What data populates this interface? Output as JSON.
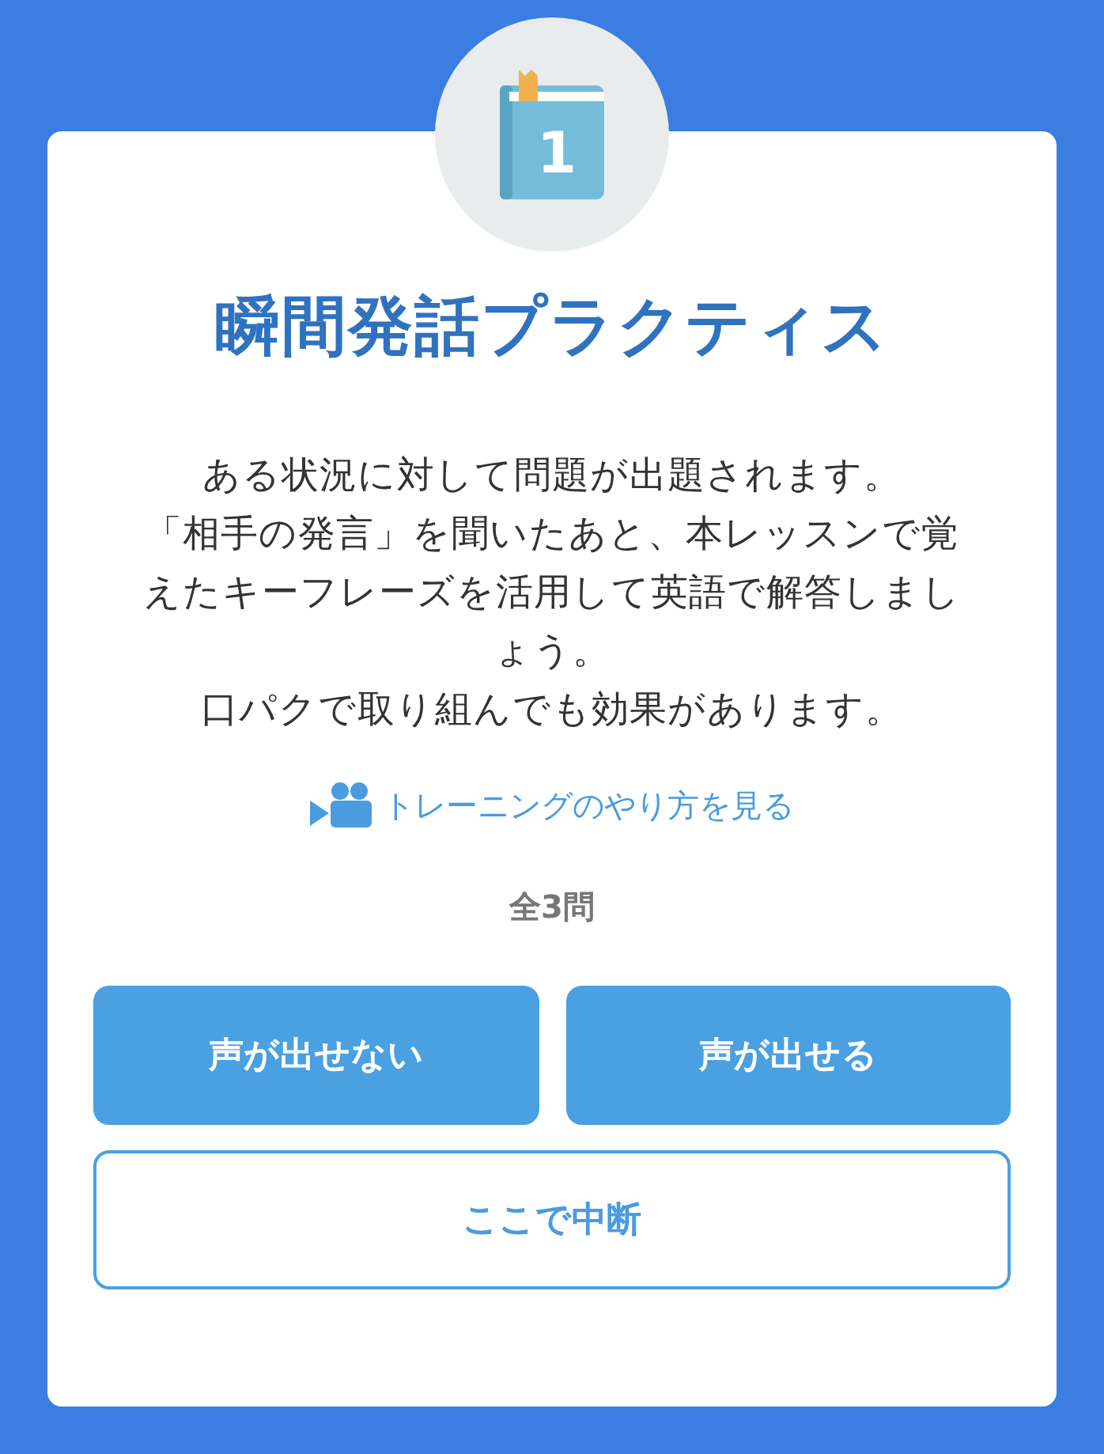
{
  "lesson_badge": {
    "number": "1"
  },
  "title": "瞬間発話プラクティス",
  "description": [
    "ある状況に対して問題が出題されます。",
    "「相手の発言」を聞いたあと、本レッスンで覚えたキーフレーズを活用して英語で解答しましょう。",
    "口パクで取り組んでも効果があります。"
  ],
  "video_link": "トレーニングのやり方を見る",
  "question_count": "全3問",
  "buttons": [
    {
      "label": "声が出せない",
      "kind": "filled"
    },
    {
      "label": "声が出せる",
      "kind": "filled"
    },
    {
      "label": "ここで中断",
      "kind": "outline"
    }
  ]
}
